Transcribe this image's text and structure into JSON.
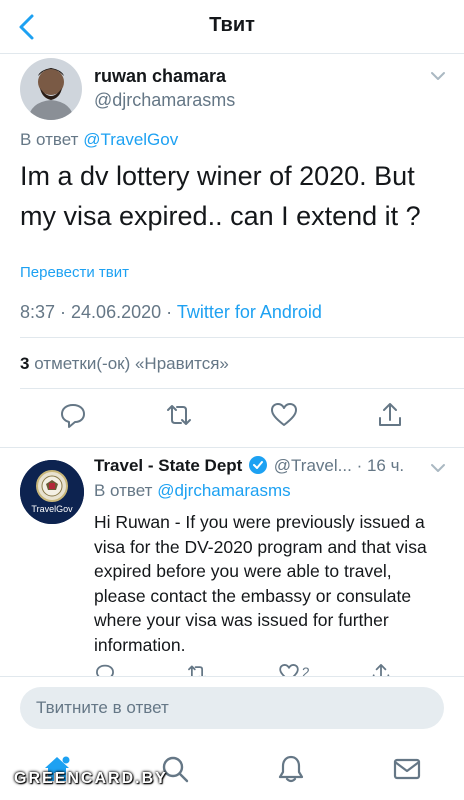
{
  "nav": {
    "title": "Твит"
  },
  "tweet": {
    "author_name": "ruwan chamara",
    "author_handle": "@djrchamarasms",
    "reply_prefix": "В ответ",
    "reply_to": "@TravelGov",
    "text": "Im a dv lottery winer of 2020. But my visa expired.. can I extend it ?",
    "translate_label": "Перевести твит",
    "timestamp": "8:37 · 24.06.2020 ·",
    "source": "Twitter for Android",
    "likes_count": "3",
    "likes_label": "отметки(-ок) «Нравится»"
  },
  "reply": {
    "name": "Travel - State Dept",
    "handle": "@Travel...",
    "time": "· 16 ч.",
    "reply_prefix": "В ответ",
    "reply_to": "@djrchamarasms",
    "avatar_text": "TravelGov",
    "text": "Hi Ruwan - If you were previously issued a visa for the DV-2020 program and that visa expired before you were able to travel, please contact the embassy or consulate where your visa was issued for further information.",
    "like_count": "2"
  },
  "composer": {
    "placeholder": "Твитните в ответ"
  },
  "watermark": "GREENCARD.BY",
  "colors": {
    "accent": "#1da1f2",
    "secondary_text": "#657786",
    "divider": "#e1e8ed"
  },
  "icons": {
    "nav": "back-chevron-icon",
    "tweet_actions": [
      "reply-icon",
      "retweet-icon",
      "like-icon",
      "share-icon"
    ],
    "tabs": [
      "home-icon",
      "search-icon",
      "notifications-icon",
      "messages-icon"
    ]
  }
}
